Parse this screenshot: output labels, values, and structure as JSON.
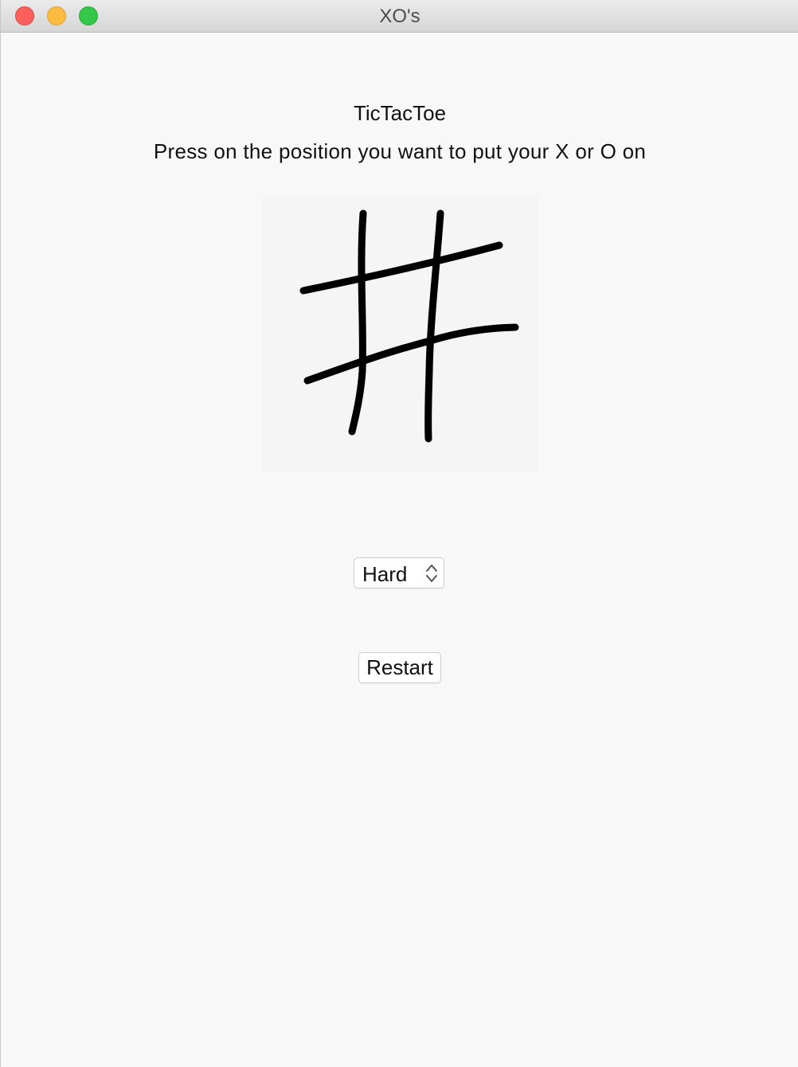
{
  "window": {
    "title": "XO's"
  },
  "main": {
    "heading": "TicTacToe",
    "instructions": "Press on the position you want to put your X or O on"
  },
  "difficulty": {
    "selected": "Hard",
    "icon": "up-down-chevron-icon"
  },
  "controls": {
    "restart_label": "Restart"
  },
  "colors": {
    "close": "#fc605c",
    "minimize": "#fdbc40",
    "maximize": "#34c84a",
    "board_lines": "#000000"
  }
}
